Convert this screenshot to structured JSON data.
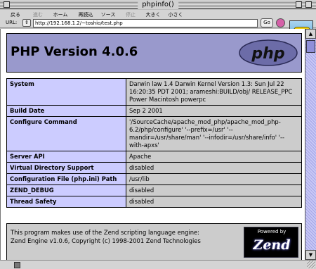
{
  "window": {
    "title": "phpinfo()"
  },
  "toolbar": {
    "buttons": [
      {
        "label": "戻る",
        "enabled": true
      },
      {
        "label": "進む",
        "enabled": false
      },
      {
        "label": "ホーム",
        "enabled": true
      },
      {
        "label": "再読込",
        "enabled": true
      },
      {
        "label": "ソース",
        "enabled": true
      },
      {
        "label": "停止",
        "enabled": false
      },
      {
        "label": "大きく",
        "enabled": true
      },
      {
        "label": "小さく",
        "enabled": true
      }
    ]
  },
  "urlbar": {
    "label": "URL:",
    "value": "http://192.168.1.2/~toshio/test.php",
    "go_label": "Go"
  },
  "page": {
    "header_title": "PHP Version 4.0.6",
    "logo_text": "php",
    "rows": [
      {
        "key": "System",
        "value": "Darwin law 1.4 Darwin Kernel Version 1.3: Sun Jul 22 16:20:35 PDT 2001; arameshi:BUILD/obj/ RELEASE_PPC Power Macintosh powerpc"
      },
      {
        "key": "Build Date",
        "value": "Sep 2 2001"
      },
      {
        "key": "Configure Command",
        "value": "'/SourceCache/apache_mod_php/apache_mod_php-6.2/php/configure' '--prefix=/usr' '--mandir=/usr/share/man' '--infodir=/usr/share/info' '--with-apxs'"
      },
      {
        "key": "Server API",
        "value": "Apache"
      },
      {
        "key": "Virtual Directory Support",
        "value": "disabled"
      },
      {
        "key": "Configuration File (php.ini) Path",
        "value": "/usr/lib"
      },
      {
        "key": "ZEND_DEBUG",
        "value": "disabled"
      },
      {
        "key": "Thread Safety",
        "value": "disabled"
      }
    ],
    "zend_line1": "This program makes use of the Zend scripting language engine:",
    "zend_line2": "Zend Engine v1.0.6, Copyright (c) 1998-2001 Zend Technologies",
    "zend_powered": "Powered by",
    "zend_word": "Zend"
  },
  "colors": {
    "header_bg": "#9999cc",
    "key_bg": "#ccccff",
    "value_bg": "#cccccc"
  }
}
